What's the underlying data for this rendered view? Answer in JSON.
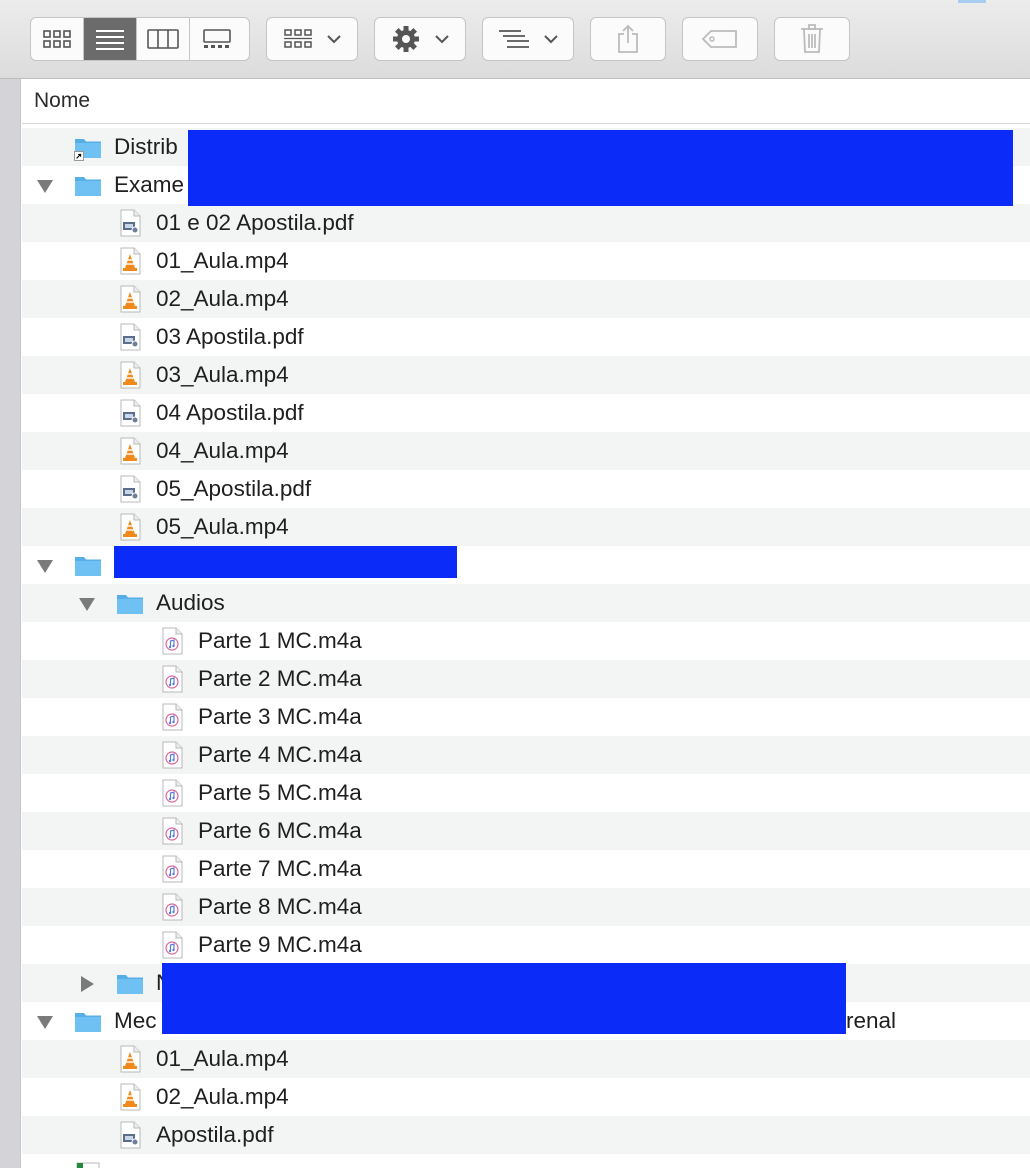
{
  "toolbar": {
    "view_modes": [
      {
        "name": "icon-view",
        "active": false
      },
      {
        "name": "list-view",
        "active": true
      },
      {
        "name": "column-view",
        "active": false
      },
      {
        "name": "gallery-view",
        "active": false
      }
    ],
    "buttons": [
      "group-by",
      "action-gear",
      "arrange",
      "share",
      "tags",
      "trash"
    ]
  },
  "header": {
    "name_column": "Nome"
  },
  "rows": [
    {
      "label": "Distrib",
      "indent": 0,
      "kind": "folder-alias",
      "disclosure": "none"
    },
    {
      "label": "Exame",
      "indent": 0,
      "kind": "folder",
      "disclosure": "open"
    },
    {
      "label": "01 e 02 Apostila.pdf",
      "indent": 1,
      "kind": "pdf",
      "disclosure": "none"
    },
    {
      "label": "01_Aula.mp4",
      "indent": 1,
      "kind": "video",
      "disclosure": "none"
    },
    {
      "label": "02_Aula.mp4",
      "indent": 1,
      "kind": "video",
      "disclosure": "none"
    },
    {
      "label": "03 Apostila.pdf",
      "indent": 1,
      "kind": "pdf",
      "disclosure": "none"
    },
    {
      "label": "03_Aula.mp4",
      "indent": 1,
      "kind": "video",
      "disclosure": "none"
    },
    {
      "label": "04 Apostila.pdf",
      "indent": 1,
      "kind": "pdf",
      "disclosure": "none"
    },
    {
      "label": "04_Aula.mp4",
      "indent": 1,
      "kind": "video",
      "disclosure": "none"
    },
    {
      "label": "05_Apostila.pdf",
      "indent": 1,
      "kind": "pdf",
      "disclosure": "none"
    },
    {
      "label": "05_Aula.mp4",
      "indent": 1,
      "kind": "video",
      "disclosure": "none"
    },
    {
      "label": "",
      "indent": 0,
      "kind": "folder",
      "disclosure": "open"
    },
    {
      "label": "Audios",
      "indent": 1,
      "kind": "folder",
      "disclosure": "open"
    },
    {
      "label": "Parte 1 MC.m4a",
      "indent": 2,
      "kind": "audio",
      "disclosure": "none"
    },
    {
      "label": "Parte 2 MC.m4a",
      "indent": 2,
      "kind": "audio",
      "disclosure": "none"
    },
    {
      "label": "Parte 3 MC.m4a",
      "indent": 2,
      "kind": "audio",
      "disclosure": "none"
    },
    {
      "label": "Parte 4 MC.m4a",
      "indent": 2,
      "kind": "audio",
      "disclosure": "none"
    },
    {
      "label": "Parte 5 MC.m4a",
      "indent": 2,
      "kind": "audio",
      "disclosure": "none"
    },
    {
      "label": "Parte 6 MC.m4a",
      "indent": 2,
      "kind": "audio",
      "disclosure": "none"
    },
    {
      "label": "Parte 7 MC.m4a",
      "indent": 2,
      "kind": "audio",
      "disclosure": "none"
    },
    {
      "label": "Parte 8 MC.m4a",
      "indent": 2,
      "kind": "audio",
      "disclosure": "none"
    },
    {
      "label": "Parte 9 MC.m4a",
      "indent": 2,
      "kind": "audio",
      "disclosure": "none"
    },
    {
      "label": "N",
      "indent": 1,
      "kind": "folder",
      "disclosure": "closed"
    },
    {
      "label": "Mec",
      "label_tail": "renal",
      "indent": 0,
      "kind": "folder",
      "disclosure": "open"
    },
    {
      "label": "01_Aula.mp4",
      "indent": 1,
      "kind": "video",
      "disclosure": "none"
    },
    {
      "label": "02_Aula.mp4",
      "indent": 1,
      "kind": "video",
      "disclosure": "none"
    },
    {
      "label": "Apostila.pdf",
      "indent": 1,
      "kind": "pdf",
      "disclosure": "none"
    },
    {
      "label": "",
      "indent": 0,
      "kind": "spreadsheet",
      "disclosure": "none"
    }
  ],
  "colors": {
    "folder": "#6ec1f2",
    "folder_tab": "#56aee6",
    "video_cone": "#f08a1c",
    "redaction": "#0b2bf8",
    "row_alt": "#f3f4f4",
    "sidebar": "#d4d4d8"
  }
}
